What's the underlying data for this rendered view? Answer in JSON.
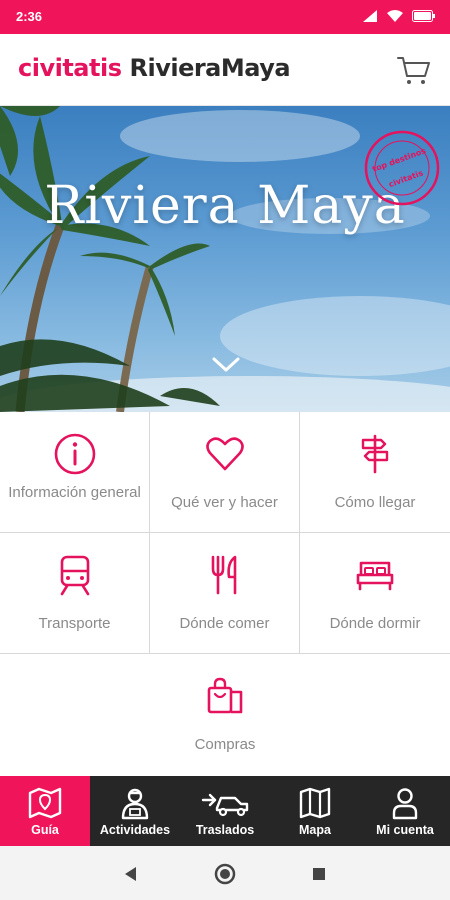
{
  "status_bar": {
    "time": "2:36",
    "bg_color": "#f0145a"
  },
  "header": {
    "brand_name": "civitatis",
    "brand_city": "RivieraMaya",
    "cart_icon": "cart-icon"
  },
  "hero": {
    "title": "Riviera Maya",
    "stamp_top": "top destinos",
    "stamp_bottom": "civitatis"
  },
  "menu": [
    {
      "label": "Información general",
      "icon": "info-icon"
    },
    {
      "label": "Qué ver y hacer",
      "icon": "heart-icon"
    },
    {
      "label": "Cómo llegar",
      "icon": "signpost-icon"
    },
    {
      "label": "Transporte",
      "icon": "train-icon"
    },
    {
      "label": "Dónde comer",
      "icon": "fork-knife-icon"
    },
    {
      "label": "Dónde dormir",
      "icon": "bed-icon"
    },
    {
      "label": "Compras",
      "icon": "shopping-bags-icon"
    }
  ],
  "bottom_nav": [
    {
      "label": "Guía",
      "icon": "map-icon",
      "active": true
    },
    {
      "label": "Actividades",
      "icon": "guide-person-icon",
      "active": false
    },
    {
      "label": "Traslados",
      "icon": "car-transfer-icon",
      "active": false
    },
    {
      "label": "Mapa",
      "icon": "folded-map-icon",
      "active": false
    },
    {
      "label": "Mi cuenta",
      "icon": "user-icon",
      "active": false
    }
  ],
  "colors": {
    "accent": "#e5125d",
    "nav_bg": "#262626",
    "label_gray": "#8a8a8a"
  }
}
